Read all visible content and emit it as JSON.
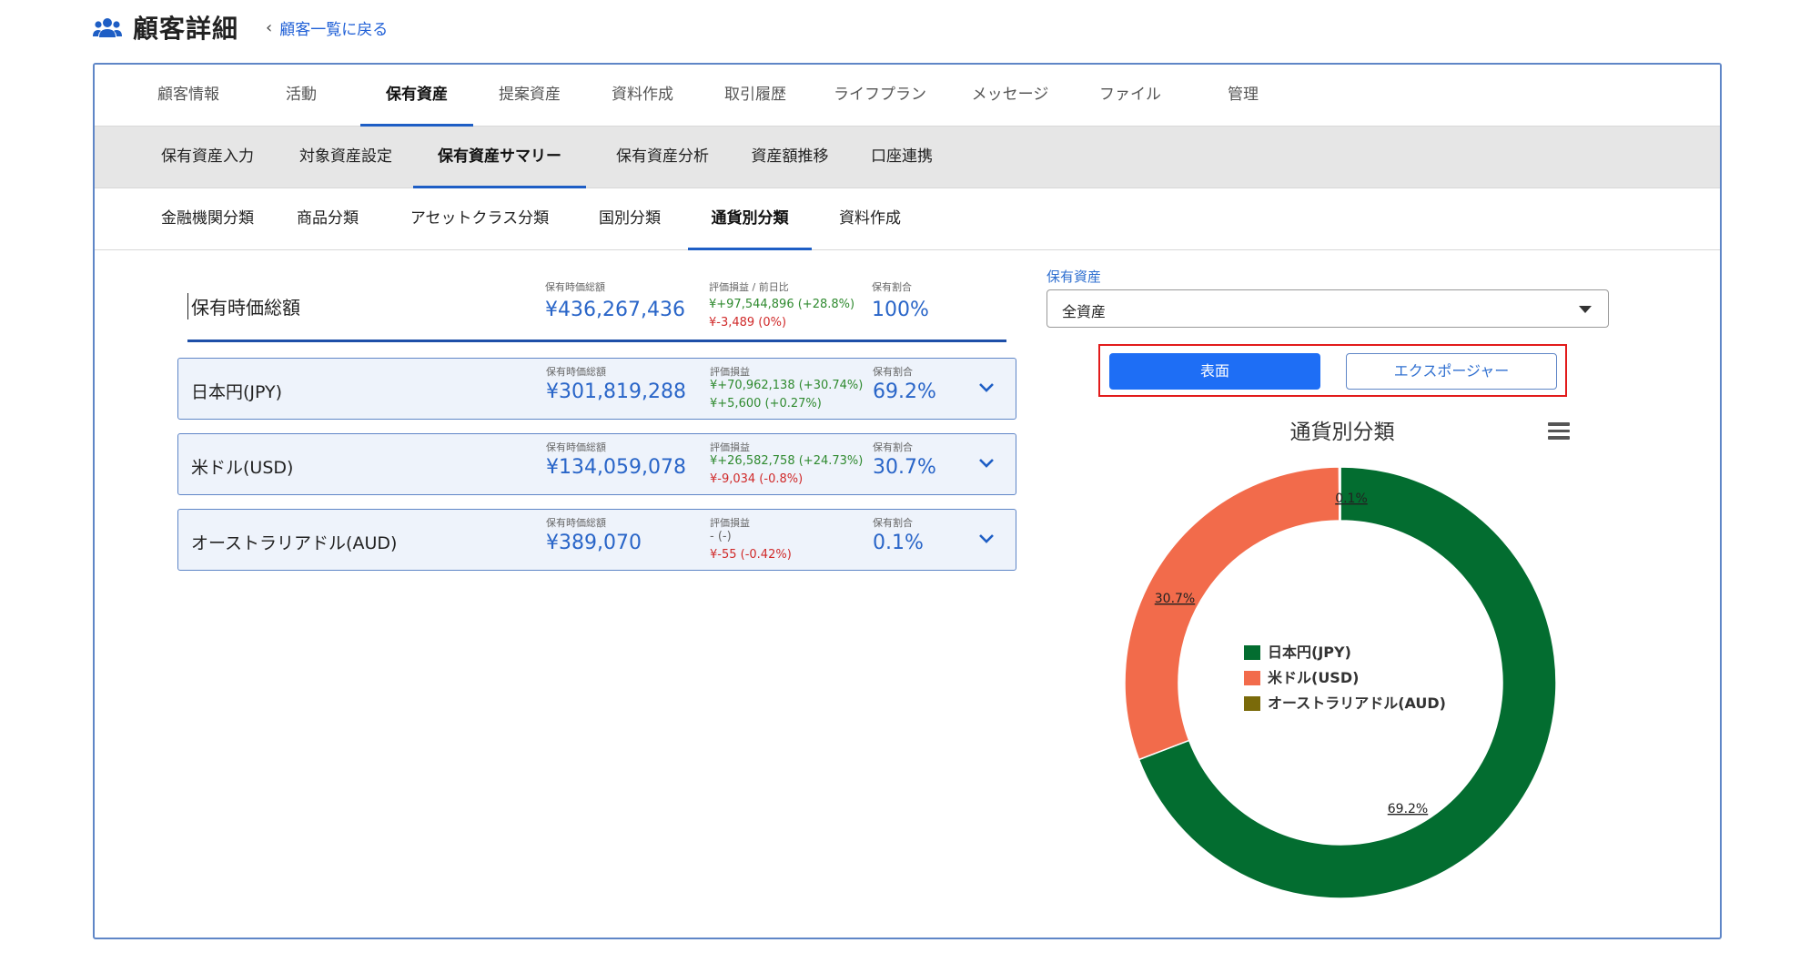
{
  "header": {
    "title": "顧客詳細",
    "back_link": "顧客一覧に戻る"
  },
  "tabs_main": [
    "顧客情報",
    "活動",
    "保有資産",
    "提案資産",
    "資料作成",
    "取引履歴",
    "ライフプラン",
    "メッセージ",
    "ファイル",
    "管理"
  ],
  "tabs_sub": [
    "保有資産入力",
    "対象資産設定",
    "保有資産サマリー",
    "保有資産分析",
    "資産額推移",
    "口座連携"
  ],
  "tabs_third": [
    "金融機関分類",
    "商品分類",
    "アセットクラス分類",
    "国別分類",
    "通貨別分類",
    "資料作成"
  ],
  "summary": {
    "label": "保有時価総額",
    "value_caption": "保有時価総額",
    "value": "¥436,267,436",
    "pl_caption": "評価損益 / 前日比",
    "pl": "¥+97,544,896 (+28.8%)",
    "daily": "¥-3,489 (0%)",
    "ratio_caption": "保有割合",
    "ratio": "100%"
  },
  "rows": [
    {
      "name": "日本円(JPY)",
      "value_caption": "保有時価総額",
      "value": "¥301,819,288",
      "pl_caption": "評価損益",
      "pl": "¥+70,962,138 (+30.74%)",
      "daily": "¥+5,600 (+0.27%)",
      "ratio_caption": "保有割合",
      "ratio": "69.2%"
    },
    {
      "name": "米ドル(USD)",
      "value_caption": "保有時価総額",
      "value": "¥134,059,078",
      "pl_caption": "評価損益",
      "pl": "¥+26,582,758 (+24.73%)",
      "daily": "¥-9,034 (-0.8%)",
      "ratio_caption": "保有割合",
      "ratio": "30.7%"
    },
    {
      "name": "オーストラリアドル(AUD)",
      "value_caption": "保有時価総額",
      "value": "¥389,070",
      "pl_caption": "評価損益",
      "pl": "- (-)",
      "daily": "¥-55 (-0.42%)",
      "ratio_caption": "保有割合",
      "ratio": "0.1%"
    }
  ],
  "right_panel": {
    "select_label": "保有資産",
    "select_value": "全資産",
    "btn_primary": "表面",
    "btn_secondary": "エクスポージャー"
  },
  "chart_data": {
    "type": "pie",
    "title": "通貨別分類",
    "donut": true,
    "legend_position": "center",
    "categories": [
      "日本円(JPY)",
      "米ドル(USD)",
      "オーストラリアドル(AUD)"
    ],
    "values": [
      69.2,
      30.7,
      0.1
    ],
    "data_labels": [
      "69.2%",
      "30.7%",
      "0.1%"
    ],
    "colors": [
      "#036d30",
      "#f26b4b",
      "#7a6a0a"
    ]
  },
  "colors": {
    "accent": "#1e5ec5",
    "primary_button": "#1e6ef5",
    "positive": "#2f8a2f",
    "negative": "#d02a2a",
    "highlight": "#e21b1b"
  }
}
